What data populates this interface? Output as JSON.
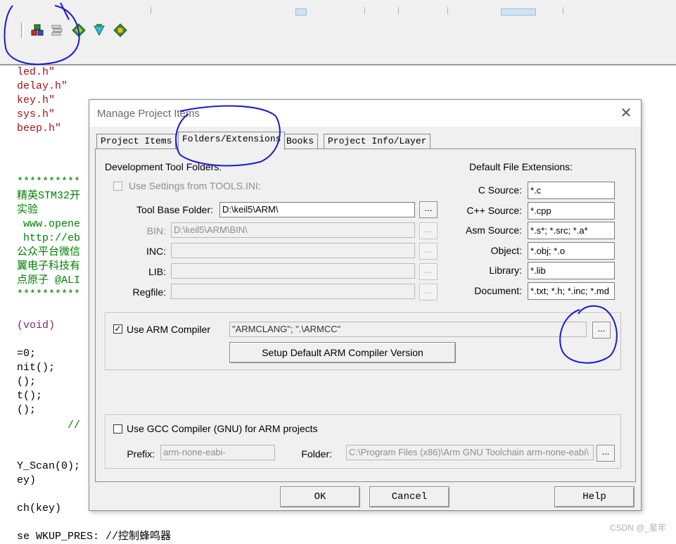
{
  "toolbar": {
    "icons": [
      "load-icon",
      "manage-components-icon",
      "pack-installer-icon",
      "select-packs-icon",
      "manage-run-time-env-icon"
    ]
  },
  "code_lines": [
    {
      "prefix": "",
      "text": "led.h\"",
      "cls": "c-str"
    },
    {
      "prefix": "",
      "text": "delay.h\"",
      "cls": "c-str"
    },
    {
      "prefix": "",
      "text": "key.h\"",
      "cls": "c-str"
    },
    {
      "prefix": "",
      "text": "sys.h\"",
      "cls": "c-str"
    },
    {
      "prefix": "",
      "text": "beep.h\"",
      "cls": "c-str"
    },
    {
      "prefix": "",
      "text": "**********",
      "cls": "c-cmt"
    },
    {
      "prefix": "",
      "text": "精英STM32开",
      "cls": "c-cmt"
    },
    {
      "prefix": "",
      "text": "实验",
      "cls": "c-cmt"
    },
    {
      "prefix": "",
      "text": " www.opene",
      "cls": "c-cmt"
    },
    {
      "prefix": "",
      "text": " http://eb",
      "cls": "c-cmt"
    },
    {
      "prefix": "",
      "text": "公众平台微信",
      "cls": "c-cmt"
    },
    {
      "prefix": "",
      "text": "翼电子科技有",
      "cls": "c-cmt"
    },
    {
      "prefix": "",
      "text": "点原子 @ALI",
      "cls": "c-cmt"
    },
    {
      "prefix": "",
      "text": "**********",
      "cls": "c-cmt"
    },
    {
      "prefix": "",
      "text": "(void)",
      "cls": "c-kw"
    },
    {
      "prefix": "",
      "text": "=0;",
      "cls": "c-fn"
    },
    {
      "prefix": "",
      "text": "nit();",
      "cls": "c-fn"
    },
    {
      "prefix": "",
      "text": "();",
      "cls": "c-fn"
    },
    {
      "prefix": "",
      "text": "t();",
      "cls": "c-fn"
    },
    {
      "prefix": "",
      "text": "();",
      "cls": "c-fn"
    },
    {
      "prefix": "",
      "text": "        //",
      "cls": "c-cmt"
    },
    {
      "prefix": "",
      "text": "Y_Scan(0);",
      "cls": "c-fn"
    },
    {
      "prefix": "",
      "text": "ey)",
      "cls": "c-fn"
    },
    {
      "prefix": "",
      "text": "ch(key)",
      "cls": "c-fn"
    },
    {
      "prefix": "",
      "text": "se WKUP_PRES: //控制蜂鸣器",
      "cls": "c-fn"
    }
  ],
  "dialog": {
    "title": "Manage Project Items",
    "close_glyph": "✕",
    "tabs": [
      "Project Items",
      "Folders/Extensions",
      "Books",
      "Project Info/Layer"
    ],
    "active_tab": 1,
    "dev_tool_folders_label": "Development Tool Folders:",
    "use_settings_label": "Use Settings from TOOLS.INI:",
    "use_settings_checked": false,
    "tool_base_label": "Tool Base Folder:",
    "tool_base_value": "D:\\keil5\\ARM\\",
    "bin_label": "BIN:",
    "bin_value": "D:\\keil5\\ARM\\BIN\\",
    "inc_label": "INC:",
    "inc_value": "",
    "lib_label": "LIB:",
    "lib_value": "",
    "regfile_label": "Regfile:",
    "regfile_value": "",
    "browse_label": "...",
    "default_ext_label": "Default File Extensions:",
    "extensions": [
      {
        "label": "C Source:",
        "value": "*.c"
      },
      {
        "label": "C++ Source:",
        "value": "*.cpp"
      },
      {
        "label": "Asm Source:",
        "value": "*.s*; *.src; *.a*"
      },
      {
        "label": "Object:",
        "value": "*.obj; *.o"
      },
      {
        "label": "Library:",
        "value": "*.lib"
      },
      {
        "label": "Document:",
        "value": "*.txt; *.h; *.inc; *.md"
      }
    ],
    "use_arm_label": "Use ARM Compiler",
    "use_arm_checked": true,
    "arm_compiler_value": "\"ARMCLANG\"; \".\\ARMCC\"",
    "setup_default_label": "Setup Default ARM Compiler Version",
    "use_gcc_label": "Use GCC Compiler (GNU) for ARM projects",
    "use_gcc_checked": false,
    "prefix_label": "Prefix:",
    "prefix_value": "arm-none-eabi-",
    "folder_label": "Folder:",
    "folder_value": "C:\\Program Files (x86)\\Arm GNU Toolchain arm-none-eabi\\",
    "ok_label": "OK",
    "cancel_label": "Cancel",
    "help_label": "Help"
  },
  "watermark": "CSDN @_星年",
  "colors": {
    "annotation": "#1a1ad0",
    "dialog_bg": "#f0f0f0",
    "title_text": "#6b6b6b"
  }
}
